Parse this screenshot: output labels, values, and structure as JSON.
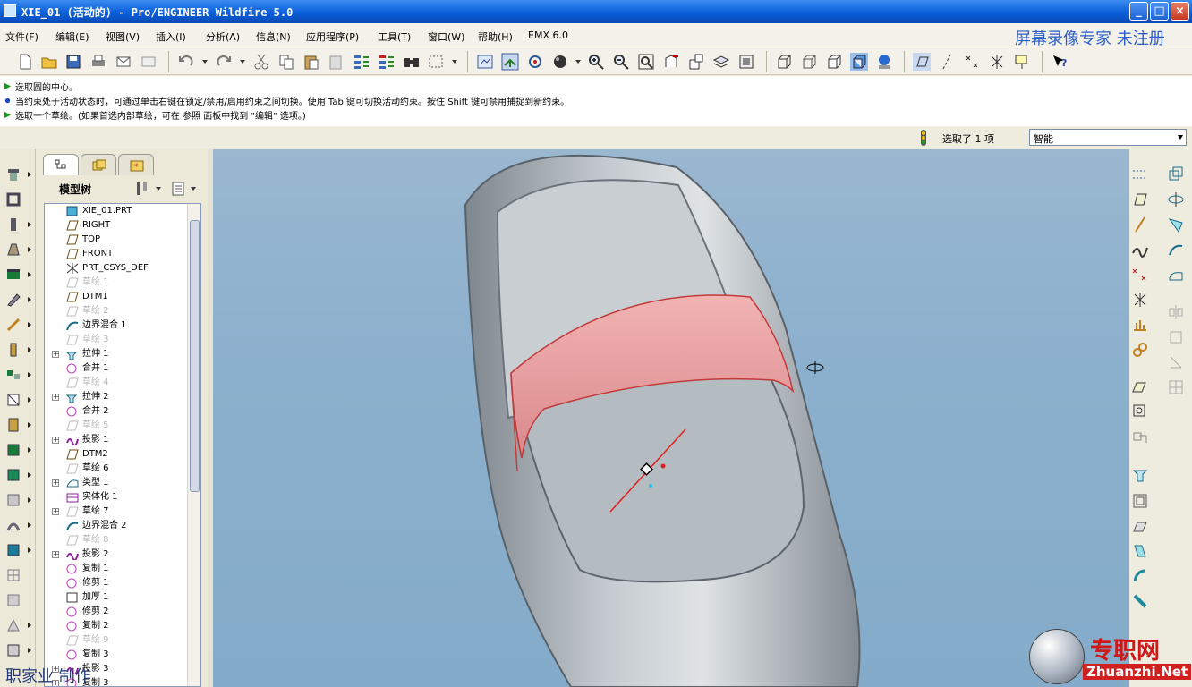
{
  "window": {
    "title": "XIE_01 (活动的) - Pro/ENGINEER Wildfire 5.0",
    "minimize_glyph": "_",
    "maximize_glyph": "□",
    "close_glyph": "×"
  },
  "menubar": {
    "items": [
      "文件(F)",
      "编辑(E)",
      "视图(V)",
      "插入(I)",
      "分析(A)",
      "信息(N)",
      "应用程序(P)",
      "工具(T)",
      "窗口(W)",
      "帮助(H)",
      "EMX 6.0"
    ]
  },
  "watermark_top": "屏幕录像专家  未注册",
  "messages": [
    "选取圆的中心。",
    "当约束处于活动状态时，可通过单击右键在锁定/禁用/启用约束之间切换。使用 Tab 键可切换活动约束。按住 Shift 键可禁用捕捉到新约束。",
    "选取一个草绘。(如果首选内部草绘，可在 参照 面板中找到 \"编辑\" 选项。)"
  ],
  "status": {
    "selected": "选取了 1 项",
    "filter": "智能"
  },
  "navigator": {
    "tree_label": "模型树"
  },
  "model_tree": [
    {
      "label": "XIE_01.PRT",
      "icon": "part-icon",
      "expand": "",
      "dim": false
    },
    {
      "label": "RIGHT",
      "icon": "datum-plane-icon",
      "expand": "",
      "dim": false
    },
    {
      "label": "TOP",
      "icon": "datum-plane-icon",
      "expand": "",
      "dim": false
    },
    {
      "label": "FRONT",
      "icon": "datum-plane-icon",
      "expand": "",
      "dim": false
    },
    {
      "label": "PRT_CSYS_DEF",
      "icon": "csys-icon",
      "expand": "",
      "dim": false
    },
    {
      "label": "草绘 1",
      "icon": "sketch-icon",
      "expand": "",
      "dim": true
    },
    {
      "label": "DTM1",
      "icon": "datum-plane-icon",
      "expand": "",
      "dim": false
    },
    {
      "label": "草绘 2",
      "icon": "sketch-icon",
      "expand": "",
      "dim": true
    },
    {
      "label": "边界混合 1",
      "icon": "boundary-blend-icon",
      "expand": "",
      "dim": false
    },
    {
      "label": "草绘 3",
      "icon": "sketch-icon",
      "expand": "",
      "dim": true
    },
    {
      "label": "拉伸 1",
      "icon": "extrude-icon",
      "expand": "+",
      "dim": false
    },
    {
      "label": "合并 1",
      "icon": "merge-icon",
      "expand": "",
      "dim": false
    },
    {
      "label": "草绘 4",
      "icon": "sketch-icon",
      "expand": "",
      "dim": true
    },
    {
      "label": "拉伸 2",
      "icon": "extrude-icon",
      "expand": "+",
      "dim": false
    },
    {
      "label": "合并 2",
      "icon": "merge-icon",
      "expand": "",
      "dim": false
    },
    {
      "label": "草绘 5",
      "icon": "sketch-icon",
      "expand": "",
      "dim": true
    },
    {
      "label": "投影 1",
      "icon": "projection-icon",
      "expand": "+",
      "dim": false
    },
    {
      "label": "DTM2",
      "icon": "datum-plane-icon",
      "expand": "",
      "dim": false
    },
    {
      "label": "草绘 6",
      "icon": "sketch-icon",
      "expand": "",
      "dim": false
    },
    {
      "label": "类型 1",
      "icon": "type-icon",
      "expand": "+",
      "dim": false
    },
    {
      "label": "实体化 1",
      "icon": "solidify-icon",
      "expand": "",
      "dim": false
    },
    {
      "label": "草绘 7",
      "icon": "sketch-icon",
      "expand": "+",
      "dim": false
    },
    {
      "label": "边界混合 2",
      "icon": "boundary-blend-icon",
      "expand": "",
      "dim": false
    },
    {
      "label": "草绘 8",
      "icon": "sketch-icon",
      "expand": "",
      "dim": true
    },
    {
      "label": "投影 2",
      "icon": "projection-icon",
      "expand": "+",
      "dim": false
    },
    {
      "label": "复制 1",
      "icon": "copy-icon",
      "expand": "",
      "dim": false
    },
    {
      "label": "修剪 1",
      "icon": "trim-icon",
      "expand": "",
      "dim": false
    },
    {
      "label": "加厚 1",
      "icon": "thicken-icon",
      "expand": "",
      "dim": false
    },
    {
      "label": "修剪 2",
      "icon": "trim-icon",
      "expand": "",
      "dim": false
    },
    {
      "label": "复制 2",
      "icon": "copy-icon",
      "expand": "",
      "dim": false
    },
    {
      "label": "草绘 9",
      "icon": "sketch-icon",
      "expand": "",
      "dim": true
    },
    {
      "label": "复制 3",
      "icon": "copy-icon",
      "expand": "",
      "dim": false
    },
    {
      "label": "投影 3",
      "icon": "projection-icon",
      "expand": "+",
      "dim": false
    },
    {
      "label": "复制 3",
      "icon": "copy-icon",
      "expand": "+",
      "dim": false
    }
  ],
  "watermark_bottom_left": "职家业  制作",
  "watermark_logo": {
    "cn": "专职网",
    "url": "Zhuanzhi.Net"
  },
  "colors": {
    "title_blue": "#0a5fd8",
    "viewport_bg": "#8bb0cd",
    "model_gray": "#b8bfc6",
    "band_red": "#e29a9c",
    "sketch_red": "#e0201c",
    "watermark_red": "#d01818"
  }
}
